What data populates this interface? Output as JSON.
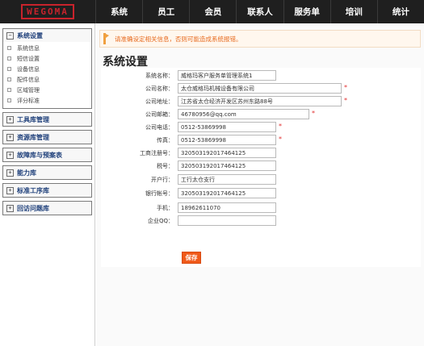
{
  "brand": {
    "logo_text": "WEGOMA"
  },
  "nav": [
    "系统",
    "员工",
    "会员",
    "联系人",
    "服务单",
    "培训",
    "统计"
  ],
  "sidebar": {
    "groups": [
      {
        "label": "系统设置",
        "expanded": true,
        "items": [
          "系统信息",
          "短信设置",
          "设备信息",
          "配件信息",
          "区域管理",
          "评分标准"
        ]
      },
      {
        "label": "工具库管理"
      },
      {
        "label": "资源库管理"
      },
      {
        "label": "故障库与预案表"
      },
      {
        "label": "能力库"
      },
      {
        "label": "标准工序库"
      },
      {
        "label": "回访问题库"
      }
    ]
  },
  "notice": "请准确设定相关信息，否则可能造成系统报错。",
  "page_title": "系统设置",
  "form": {
    "fields": [
      {
        "label": "系统名称：",
        "value": "威格玛客户服务单管理系统1",
        "required": false
      },
      {
        "label": "公司名称：",
        "value": "太仓威格玛机械设备有限公司",
        "required": true
      },
      {
        "label": "公司地址：",
        "value": "江苏省太仓经济开发区苏州东路88号",
        "required": true
      },
      {
        "label": "公司邮箱：",
        "value": "46780956@qq.com",
        "required": true
      },
      {
        "label": "公司电话：",
        "value": "0512-53869998",
        "required": true
      },
      {
        "label": "传真：",
        "value": "0512-53869998",
        "required": true
      },
      {
        "label": "工商注册号：",
        "value": "320503192017464125",
        "required": false
      },
      {
        "label": "税号：",
        "value": "320503192017464125",
        "required": false
      },
      {
        "label": "开户行：",
        "value": "工行太仓支行",
        "required": false
      },
      {
        "label": "银行帐号：",
        "value": "320503192017464125",
        "required": false
      },
      {
        "label": "手机：",
        "value": "18962611070",
        "required": false
      },
      {
        "label": "企业QQ：",
        "value": "",
        "required": false
      }
    ],
    "required_mark": "*",
    "save_label": "保存"
  },
  "colors": {
    "accent": "#f05a1a",
    "logo": "#c8232c",
    "topbar": "#1f1f1f",
    "notice_text": "#e76a1e"
  }
}
